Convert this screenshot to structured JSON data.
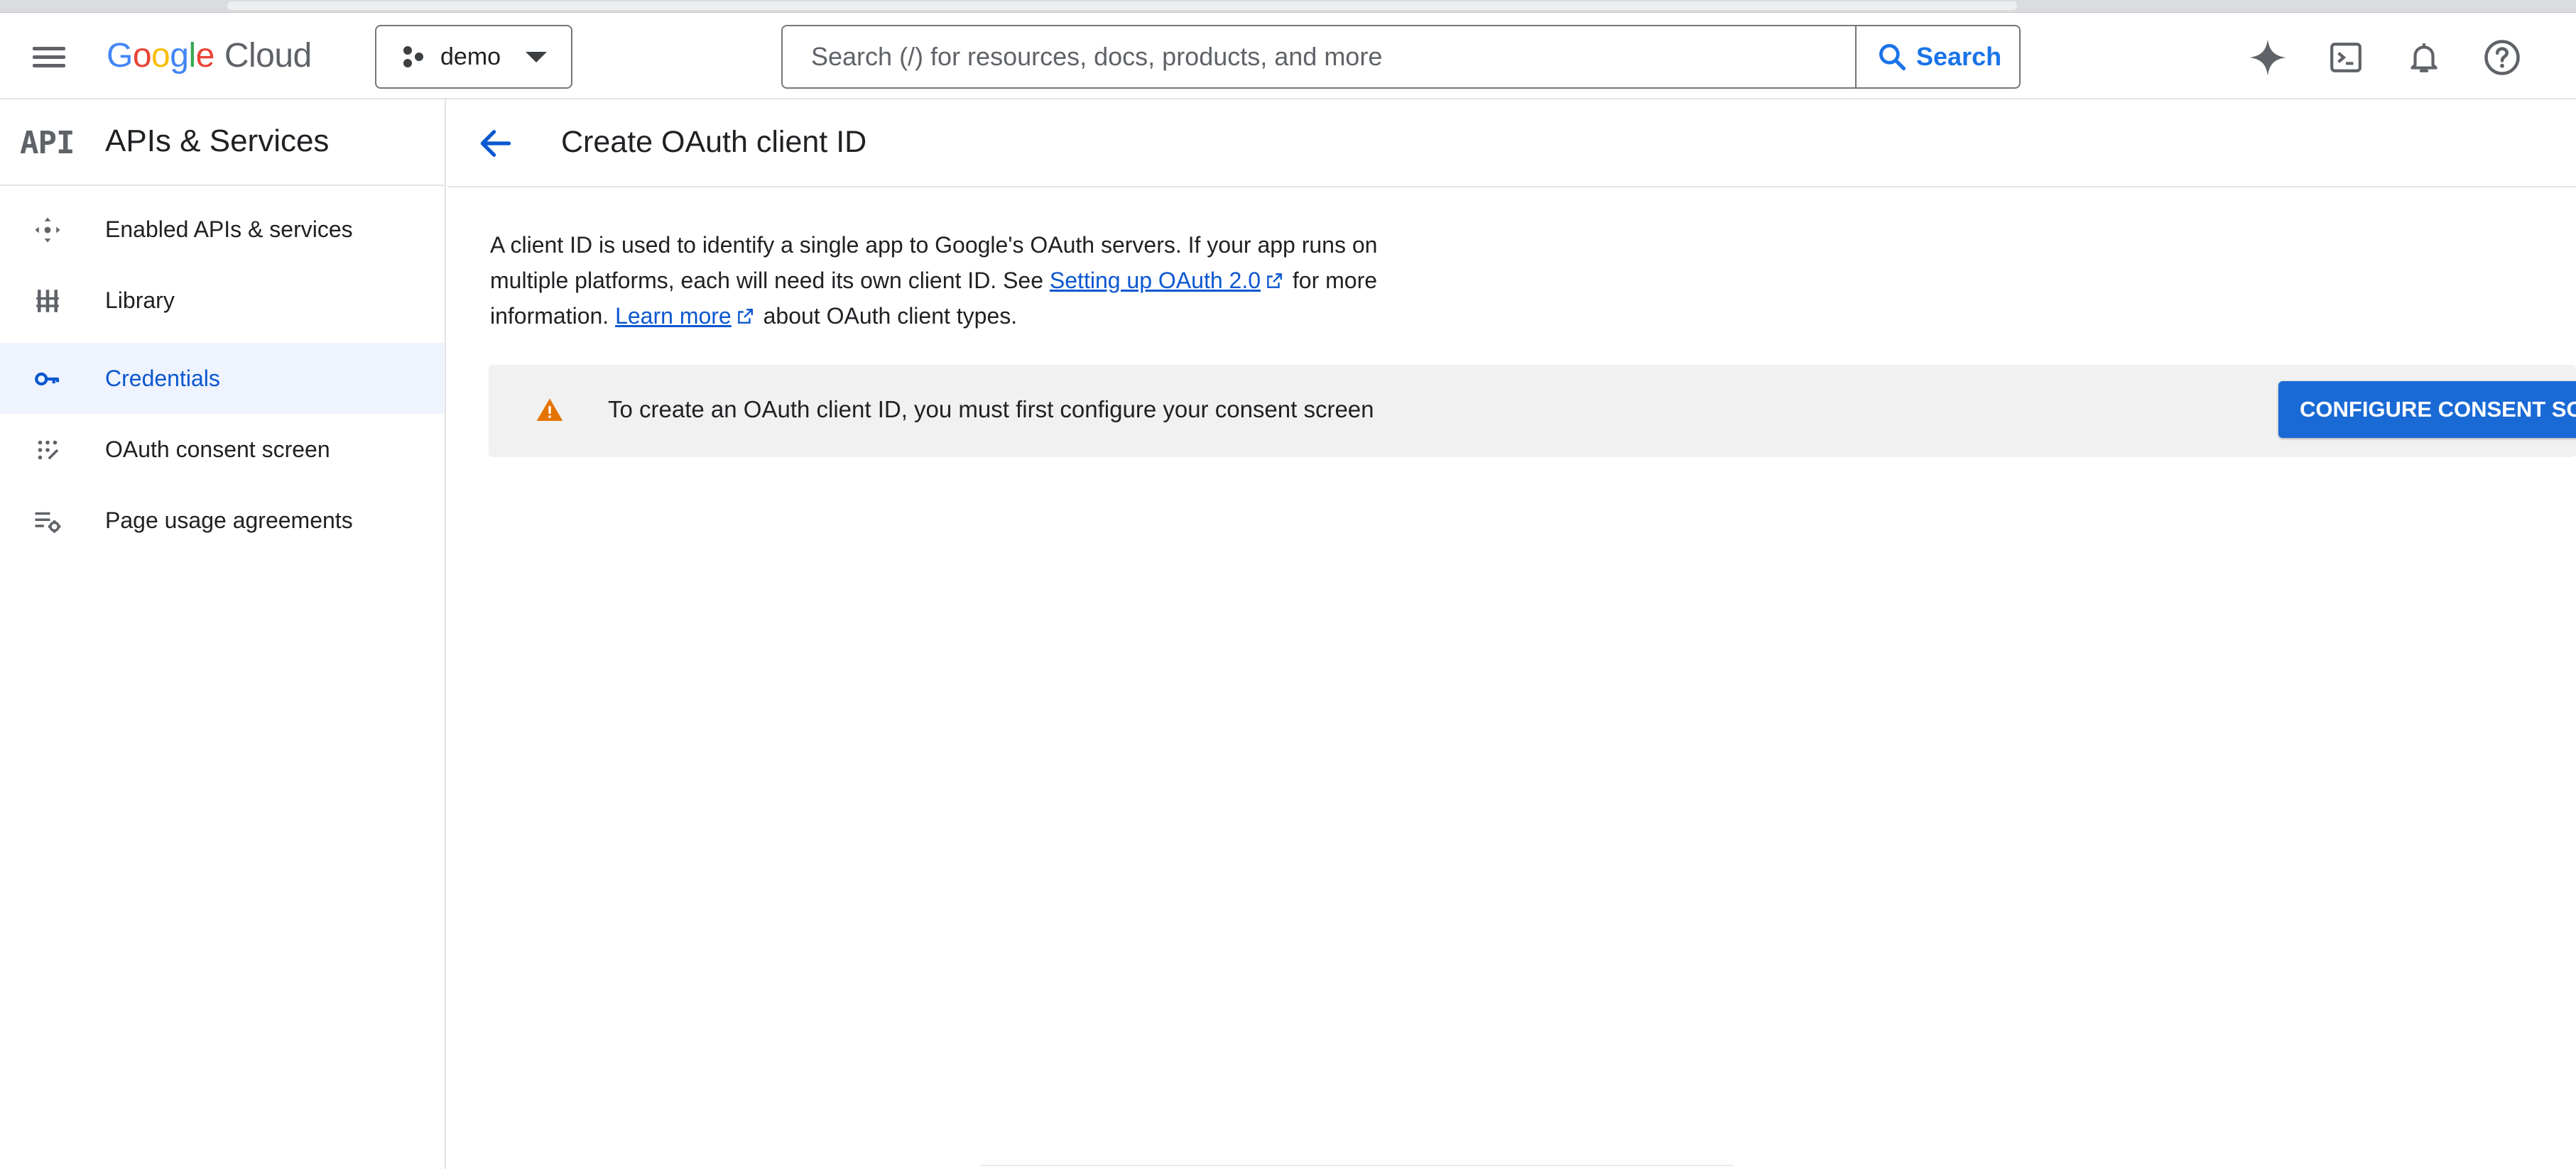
{
  "app": {
    "logo_google": [
      "G",
      "o",
      "o",
      "g",
      "l",
      "e"
    ],
    "logo_cloud": "Cloud"
  },
  "project_picker": {
    "label": "demo"
  },
  "search": {
    "placeholder": "Search (/) for resources, docs, products, and more",
    "button_label": "Search"
  },
  "top_icons": [
    "gemini-sparkle-icon",
    "cloud-shell-terminal-icon",
    "notifications-bell-icon",
    "help-icon"
  ],
  "sidebar": {
    "badge": "API",
    "title": "APIs & Services",
    "items": [
      {
        "label": "Enabled APIs & services",
        "icon": "enabled-apis-icon",
        "active": false
      },
      {
        "label": "Library",
        "icon": "library-icon",
        "active": false
      },
      {
        "label": "Credentials",
        "icon": "key-icon",
        "active": true
      },
      {
        "label": "OAuth consent screen",
        "icon": "consent-screen-icon",
        "active": false
      },
      {
        "label": "Page usage agreements",
        "icon": "settings-list-icon",
        "active": false
      }
    ]
  },
  "page": {
    "title": "Create OAuth client ID",
    "intro_part1": "A client ID is used to identify a single app to Google's OAuth servers. If your app runs on multiple platforms, each will need its own client ID. See ",
    "link_setup": "Setting up OAuth 2.0",
    "intro_part2": " for more information. ",
    "link_learn": "Learn more",
    "intro_part3": " about OAuth client types.",
    "banner_text": "To create an OAuth client ID, you must first configure your consent screen",
    "configure_button": "CONFIGURE CONSENT SCREEN"
  },
  "colors": {
    "accent": "#0b57d0",
    "button": "#1a6ad6",
    "warning": "#e37400",
    "active_bg": "#eef3fd"
  }
}
